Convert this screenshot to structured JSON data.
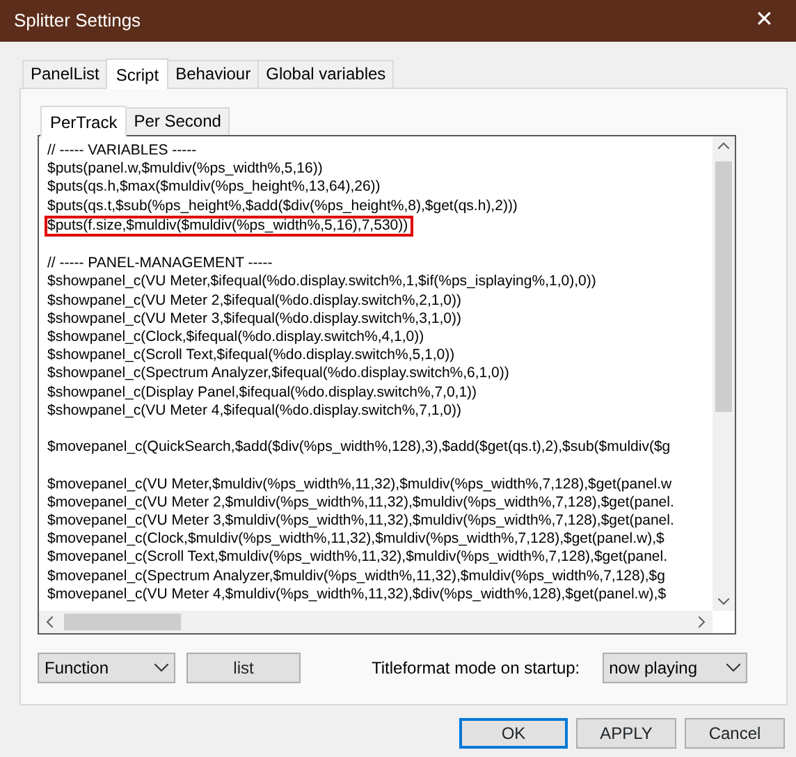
{
  "window": {
    "title": "Splitter Settings",
    "close": "✕"
  },
  "tabs": [
    {
      "label": "PanelList",
      "selected": false
    },
    {
      "label": "Script",
      "selected": true
    },
    {
      "label": "Behaviour",
      "selected": false
    },
    {
      "label": "Global variables",
      "selected": false
    }
  ],
  "subtabs": [
    {
      "label": "PerTrack",
      "selected": true
    },
    {
      "label": "Per Second",
      "selected": false
    }
  ],
  "script_blocks": [
    [
      {
        "text": "// ----- VARIABLES -----",
        "highlighted": false
      },
      {
        "text": "$puts(panel.w,$muldiv(%ps_width%,5,16))",
        "highlighted": false
      },
      {
        "text": "$puts(qs.h,$max($muldiv(%ps_height%,13,64),26))",
        "highlighted": false
      },
      {
        "text": "$puts(qs.t,$sub(%ps_height%,$add($div(%ps_height%,8),$get(qs.h),2)))",
        "highlighted": false
      },
      {
        "text": "$puts(f.size,$muldiv($muldiv(%ps_width%,5,16),7,530))",
        "highlighted": true
      }
    ],
    [
      {
        "text": "// ----- PANEL-MANAGEMENT -----",
        "highlighted": false
      },
      {
        "text": "$showpanel_c(VU Meter,$ifequal(%do.display.switch%,1,$if(%ps_isplaying%,1,0),0))",
        "highlighted": false
      },
      {
        "text": "$showpanel_c(VU Meter 2,$ifequal(%do.display.switch%,2,1,0))",
        "highlighted": false
      },
      {
        "text": "$showpanel_c(VU Meter 3,$ifequal(%do.display.switch%,3,1,0))",
        "highlighted": false
      },
      {
        "text": "$showpanel_c(Clock,$ifequal(%do.display.switch%,4,1,0))",
        "highlighted": false
      },
      {
        "text": "$showpanel_c(Scroll Text,$ifequal(%do.display.switch%,5,1,0))",
        "highlighted": false
      },
      {
        "text": "$showpanel_c(Spectrum Analyzer,$ifequal(%do.display.switch%,6,1,0))",
        "highlighted": false
      },
      {
        "text": "$showpanel_c(Display Panel,$ifequal(%do.display.switch%,7,0,1))",
        "highlighted": false
      },
      {
        "text": "$showpanel_c(VU Meter 4,$ifequal(%do.display.switch%,7,1,0))",
        "highlighted": false
      }
    ],
    [
      {
        "text": "$movepanel_c(QuickSearch,$add($div(%ps_width%,128),3),$add($get(qs.t),2),$sub($muldiv($g",
        "highlighted": false
      }
    ],
    [
      {
        "text": "$movepanel_c(VU Meter,$muldiv(%ps_width%,11,32),$muldiv(%ps_width%,7,128),$get(panel.w",
        "highlighted": false
      },
      {
        "text": "$movepanel_c(VU Meter 2,$muldiv(%ps_width%,11,32),$muldiv(%ps_width%,7,128),$get(panel.",
        "highlighted": false
      },
      {
        "text": "$movepanel_c(VU Meter 3,$muldiv(%ps_width%,11,32),$muldiv(%ps_width%,7,128),$get(panel.",
        "highlighted": false
      },
      {
        "text": "$movepanel_c(Clock,$muldiv(%ps_width%,11,32),$muldiv(%ps_width%,7,128),$get(panel.w),$",
        "highlighted": false
      },
      {
        "text": "$movepanel_c(Scroll Text,$muldiv(%ps_width%,11,32),$muldiv(%ps_width%,7,128),$get(panel.",
        "highlighted": false
      },
      {
        "text": "$movepanel_c(Spectrum Analyzer,$muldiv(%ps_width%,11,32),$muldiv(%ps_width%,7,128),$g",
        "highlighted": false
      },
      {
        "text": "$movepanel_c(VU Meter 4,$muldiv(%ps_width%,11,32),$div(%ps_width%,128),$get(panel.w),$",
        "highlighted": false
      }
    ]
  ],
  "function_select": {
    "value": "Function"
  },
  "list_button": "list",
  "titleformat": {
    "label": "Titleformat mode on startup:",
    "value": "now playing"
  },
  "buttons": [
    {
      "label": "OK",
      "default": true
    },
    {
      "label": "APPLY",
      "default": false
    },
    {
      "label": "Cancel",
      "default": false
    }
  ]
}
